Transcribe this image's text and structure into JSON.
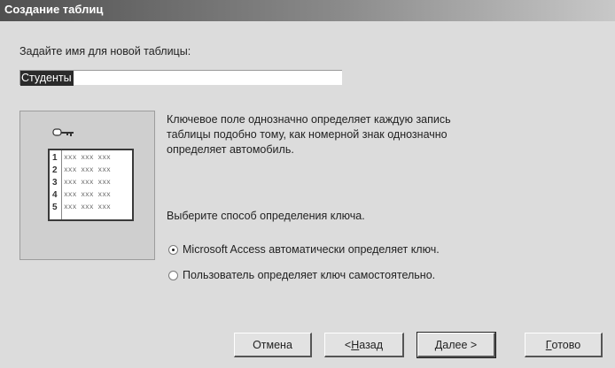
{
  "window": {
    "title": "Создание таблиц"
  },
  "name_prompt": "Задайте имя для новой таблицы:",
  "table_name_input": {
    "value": "Студенты"
  },
  "illustration": {
    "rows": [
      {
        "num": "1",
        "cells": "xxx xxx xxx"
      },
      {
        "num": "2",
        "cells": "xxx xxx xxx"
      },
      {
        "num": "3",
        "cells": "xxx xxx xxx"
      },
      {
        "num": "4",
        "cells": "xxx xxx xxx"
      },
      {
        "num": "5",
        "cells": "xxx xxx xxx"
      }
    ]
  },
  "description": {
    "line1": "Ключевое поле однозначно определяет каждую запись",
    "line2": "таблицы подобно тому, как номерной знак однозначно",
    "line3": "определяет автомобиль."
  },
  "key_prompt": "Выберите способ определения ключа.",
  "options": [
    {
      "label": "Microsoft Access автоматически определяет ключ.",
      "selected": true
    },
    {
      "label": "Пользователь определяет ключ самостоятельно.",
      "selected": false
    }
  ],
  "buttons": {
    "cancel": "Отмена",
    "back_prefix": "< ",
    "back_hotkey": "Н",
    "back_rest": "азад",
    "next_hotkey": "Д",
    "next_rest": "алее >",
    "finish_hotkey": "Г",
    "finish_rest": "отово"
  }
}
